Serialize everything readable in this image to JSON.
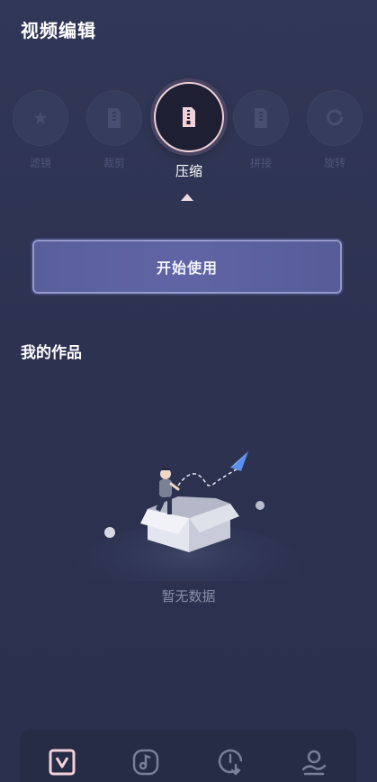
{
  "header": {
    "title": "视频编辑"
  },
  "tools": [
    {
      "label": "滤镜",
      "icon": "filter-star-icon"
    },
    {
      "label": "裁剪",
      "icon": "crop-file-icon"
    },
    {
      "label": "压缩",
      "icon": "compress-zip-icon",
      "active": true
    },
    {
      "label": "拼接",
      "icon": "splice-file-icon"
    },
    {
      "label": "旋转",
      "icon": "rotate-icon"
    }
  ],
  "start_button": {
    "label": "开始使用"
  },
  "works": {
    "title": "我的作品",
    "empty_text": "暂无数据"
  },
  "bottom_nav": [
    {
      "icon": "video-edit-tab-icon",
      "active": true
    },
    {
      "icon": "music-tab-icon"
    },
    {
      "icon": "download-tab-icon"
    },
    {
      "icon": "profile-tab-icon"
    }
  ],
  "colors": {
    "background": "#2d3352",
    "accent": "#f1d2d8",
    "button": "#5a5f9c",
    "muted_text": "#4f5677"
  }
}
